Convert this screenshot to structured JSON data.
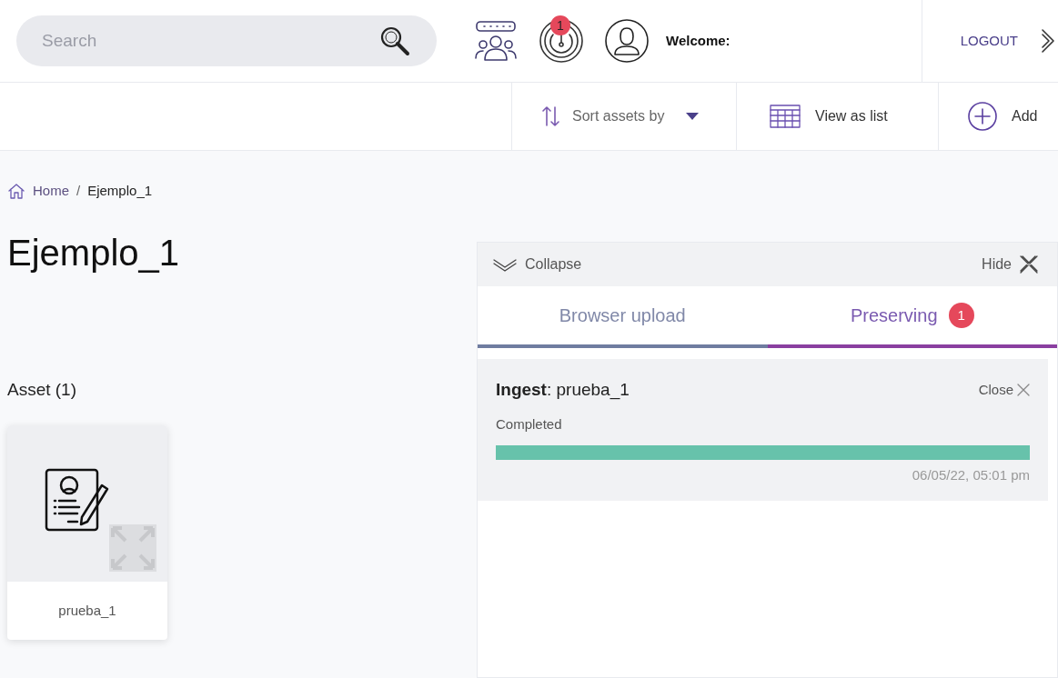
{
  "header": {
    "search": {
      "placeholder": "Search"
    },
    "notifications_badge": "1",
    "welcome": "Welcome:",
    "logout": "LOGOUT"
  },
  "toolbar": {
    "sort": "Sort assets by",
    "view": "View as list",
    "add": "Add"
  },
  "breadcrumb_separator": "/",
  "breadcrumb": [
    {
      "label": "Home",
      "kind": "link"
    },
    {
      "label": "Ejemplo_1",
      "kind": "current"
    }
  ],
  "page_title": "Ejemplo_1",
  "assets": {
    "heading": "Asset (1)",
    "items": [
      {
        "name": "prueba_1"
      }
    ]
  },
  "upload_panel": {
    "collapse": "Collapse",
    "hide": "Hide",
    "tabs": [
      {
        "label": "Browser upload",
        "selected": false
      },
      {
        "label": "Preserving",
        "selected": true,
        "badge": "1"
      }
    ],
    "jobs": [
      {
        "title": "**Ingest**: prueba_1",
        "close": "Close",
        "status": "Completed",
        "level": 1,
        "time": "06/05/22, 05:01 pm"
      }
    ]
  }
}
